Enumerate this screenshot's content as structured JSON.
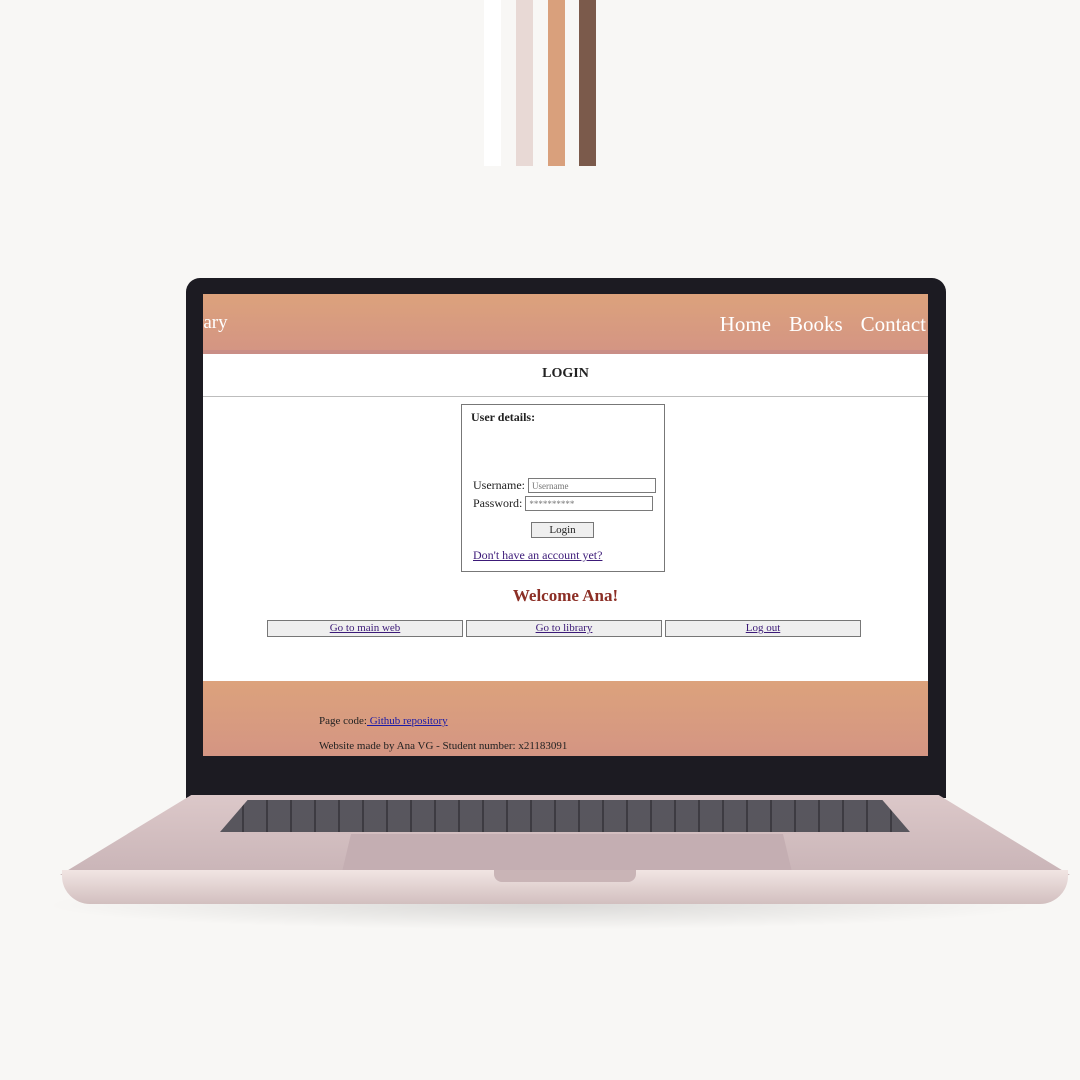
{
  "header": {
    "brand": "rary",
    "nav": [
      "Home",
      "Books",
      "Contact"
    ]
  },
  "login": {
    "title": "LOGIN",
    "legend": "User details:",
    "username_label": "Username:",
    "username_placeholder": "Username",
    "password_label": "Password:",
    "password_value": "**********",
    "button": "Login",
    "signup_link": "Don't have an account yet?"
  },
  "welcome": "Welcome Ana!",
  "actions": [
    "Go to main web",
    "Go to library",
    "Log out"
  ],
  "footer": {
    "code_label": "Page code:",
    "code_link": " Github repository",
    "made_by": "Website made by Ana VG - Student number: x21183091"
  },
  "colors": {
    "header_gradient": [
      "#dca27c",
      "#d49583"
    ],
    "welcome": "#8c2f26",
    "stripes": [
      "#ffffff",
      "#e8d9d5",
      "#d9a07c",
      "#7b5a4b"
    ]
  }
}
